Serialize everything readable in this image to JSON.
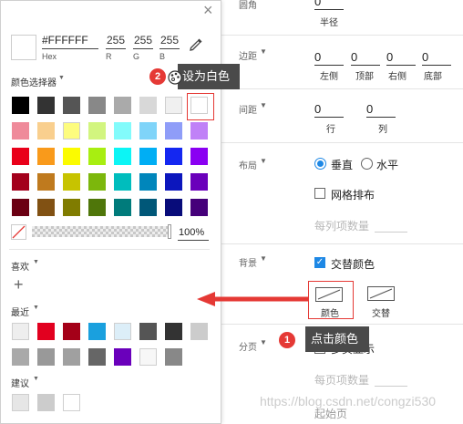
{
  "settings": {
    "size_section": {
      "label": "圆角",
      "value": "0",
      "sub": "半径"
    },
    "margin": {
      "label": "边距",
      "left": "0",
      "top": "0",
      "right": "0",
      "bottom": "0",
      "left_sub": "左侧",
      "top_sub": "顶部",
      "right_sub": "右侧",
      "bottom_sub": "底部"
    },
    "spacing": {
      "label": "间距",
      "row": "0",
      "col": "0",
      "row_sub": "行",
      "col_sub": "列"
    },
    "layout": {
      "label": "布局",
      "vertical": "垂直",
      "horizontal": "水平",
      "grid": "网格排布",
      "per_row": "每列项数量"
    },
    "background": {
      "label": "背景",
      "alternate": "交替颜色",
      "color_btn": "颜色",
      "alt_btn": "交替"
    },
    "pagination": {
      "label": "分页",
      "multi": "多页显示",
      "per_page": "每页项数量",
      "start": "起始页"
    }
  },
  "picker": {
    "close_glyph": "×",
    "hex_value": "#FFFFFF",
    "hex_label": "Hex",
    "r": "255",
    "g": "255",
    "b": "255",
    "r_label": "R",
    "g_label": "G",
    "b_label": "B",
    "selector_label": "颜色选择器",
    "palette": [
      [
        "#000000",
        "#333333",
        "#555555",
        "#888888",
        "#aaaaaa",
        "#d8d8d8",
        "#f0f0f0",
        "#ffffff"
      ],
      [
        "#ef8a9a",
        "#f9cf8e",
        "#fdfc7e",
        "#d2f57f",
        "#82fbfb",
        "#7fd4f9",
        "#8f9df8",
        "#c081f7"
      ],
      [
        "#e9001a",
        "#f99a1b",
        "#fbfb00",
        "#a8ee11",
        "#0cf5f5",
        "#00aef4",
        "#1427f1",
        "#8a00f2"
      ],
      [
        "#a3001c",
        "#bf7a1e",
        "#c7c300",
        "#7cb70c",
        "#00bdbd",
        "#0086bb",
        "#0c16bd",
        "#6a00bb"
      ],
      [
        "#6b0013",
        "#815113",
        "#807c00",
        "#4f760a",
        "#007b7b",
        "#005778",
        "#080c7a",
        "#45007a"
      ]
    ],
    "opacity": "100%",
    "favorites_label": "喜欢",
    "add_glyph": "+",
    "recent_label": "最近",
    "recent": [
      [
        "#eeeeee",
        "#e2001f",
        "#a40018",
        "#1aa0de",
        "#dceef8",
        "#555555",
        "#333333",
        "#cccccc"
      ],
      [
        "#a9a9a9",
        "#999999",
        "#a0a0a0",
        "#666666",
        "#6a00bb",
        "#f7f7f7",
        "#888888"
      ]
    ],
    "suggest_label": "建议",
    "suggest": [
      "#e6e6e6",
      "#cccccc",
      "#ffffff"
    ]
  },
  "annotations": {
    "step1_num": "1",
    "step1_text": "点击颜色",
    "step2_num": "2",
    "step2_text": "设为白色",
    "watermark": "https://blog.csdn.net/congzi530"
  },
  "colors": {
    "accent": "#1e88e5",
    "annotation_red": "#e53935",
    "tooltip_bg": "#4a4a4a"
  }
}
